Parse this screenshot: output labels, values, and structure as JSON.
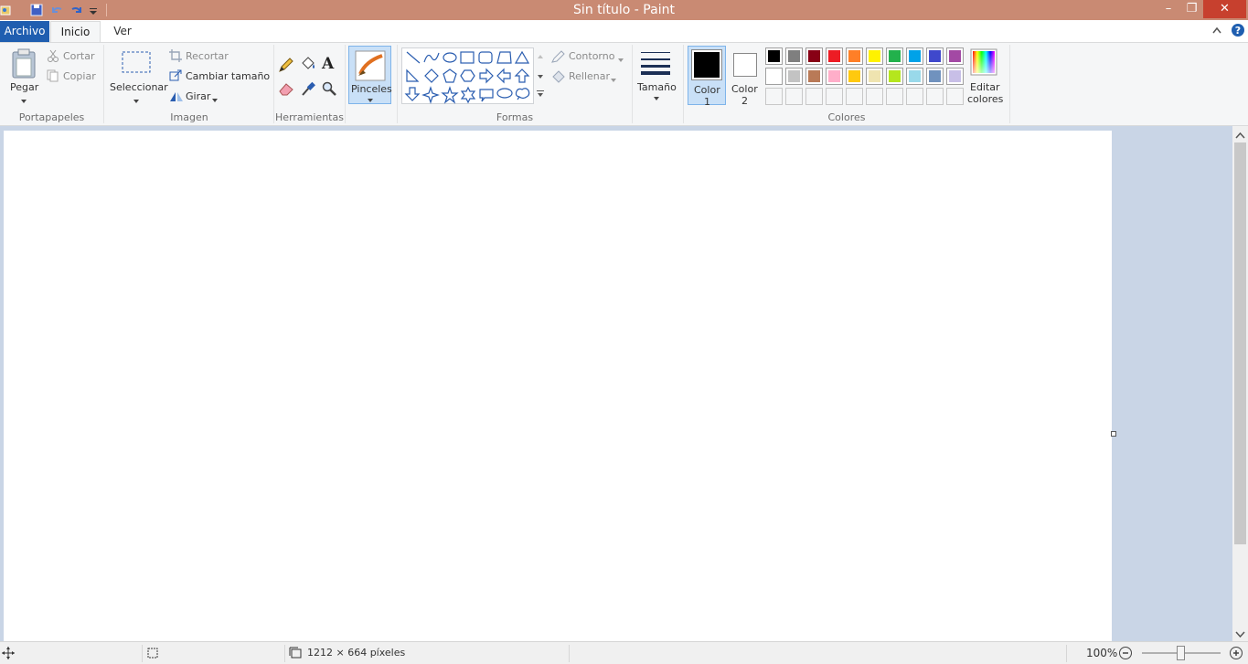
{
  "window": {
    "title": "Sin título - Paint"
  },
  "title_buttons": {
    "minimize": "–",
    "restore": "❐",
    "close": "✕"
  },
  "tabs": {
    "file": "Archivo",
    "home": "Inicio",
    "view": "Ver"
  },
  "clipboard": {
    "paste": "Pegar",
    "cut": "Cortar",
    "copy": "Copiar",
    "group": "Portapapeles"
  },
  "image": {
    "select": "Seleccionar",
    "crop": "Recortar",
    "resize": "Cambiar tamaño",
    "rotate": "Girar",
    "group": "Imagen"
  },
  "tools": {
    "group": "Herramientas",
    "text_tool": "A"
  },
  "brushes": {
    "label": "Pinceles"
  },
  "shapes": {
    "outline": "Contorno",
    "fill": "Rellenar",
    "group": "Formas"
  },
  "size": {
    "label": "Tamaño"
  },
  "colors": {
    "color1_label": "Color",
    "color1_num": "1",
    "color2_label": "Color",
    "color2_num": "2",
    "edit_label_1": "Editar",
    "edit_label_2": "colores",
    "group": "Colores",
    "color1": "#000000",
    "color2": "#ffffff",
    "palette_row1": [
      "#000000",
      "#7f7f7f",
      "#880015",
      "#ed1c24",
      "#ff7f27",
      "#fff200",
      "#22b14c",
      "#00a2e8",
      "#3f48cc",
      "#a349a4"
    ],
    "palette_row2": [
      "#ffffff",
      "#c3c3c3",
      "#b97a57",
      "#ffaec9",
      "#ffc90e",
      "#efe4b0",
      "#b5e61d",
      "#99d9ea",
      "#7092be",
      "#c8bfe7"
    ]
  },
  "status": {
    "canvas_size": "1212 × 664 píxeles",
    "zoom": "100%"
  }
}
